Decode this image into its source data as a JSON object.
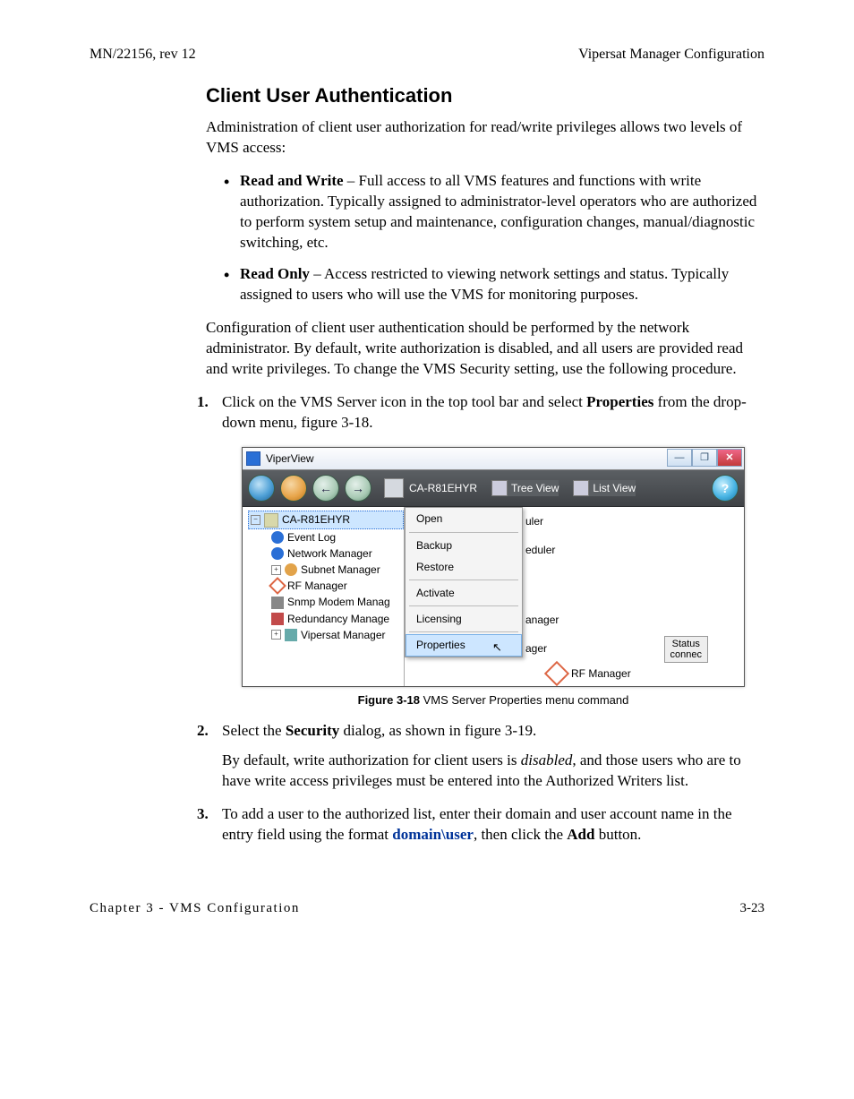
{
  "header": {
    "left": "MN/22156, rev 12",
    "right": "Vipersat Manager Configuration"
  },
  "section_title": "Client User Authentication",
  "intro": "Administration of client user authorization for read/write privileges allows two levels of VMS access:",
  "bullets": [
    {
      "bold": "Read and Write",
      "rest": " – Full access to all VMS features and functions with write authorization. Typically assigned to administrator-level operators who are authorized to perform system setup and maintenance, configuration changes, manual/diagnostic switching, etc."
    },
    {
      "bold": "Read Only",
      "rest": " – Access restricted to viewing network settings and status. Typically assigned to users who will use the VMS for monitoring purposes."
    }
  ],
  "config_para": "Configuration of client user authentication should be performed by the network administrator. By default, write authorization is disabled, and all users are provided read and write privileges. To change the VMS Security setting, use the following procedure.",
  "steps": {
    "one": {
      "num": "1.",
      "pre": "Click on the VMS Server icon in the top tool bar and select ",
      "bold": "Properties",
      "post": " from the drop-down menu, figure 3-18."
    },
    "two": {
      "num": "2.",
      "pre": "Select the ",
      "bold": "Security",
      "post": " dialog, as shown in figure 3-19.",
      "sub_pre": "By default, write authorization for client users is ",
      "sub_ital": "disabled",
      "sub_post": ", and those users who are to have write access privileges must be entered into the Authorized Writers list."
    },
    "three": {
      "num": "3.",
      "pre": "To add a user to the authorized list, enter their domain and user account name in the entry field using the format ",
      "blue": "domain\\user",
      "mid": ", then click the ",
      "bold": "Add",
      "post": " button."
    }
  },
  "figure": {
    "label_bold": "Figure 3-18",
    "label_rest": "   VMS Server Properties menu command"
  },
  "window": {
    "title": "ViperView",
    "server_name": "CA-R81EHYR",
    "tree_view": "Tree View",
    "list_view": "List View",
    "tree": {
      "root": "CA-R81EHYR",
      "items": [
        "Event Log",
        "Network Manager",
        "Subnet Manager",
        "RF Manager",
        "Snmp Modem Manag",
        "Redundancy Manage",
        "Vipersat Manager"
      ]
    },
    "context_menu": [
      "Open",
      "Backup",
      "Restore",
      "Activate",
      "Licensing",
      "Properties"
    ],
    "bg_labels": {
      "a": "uler",
      "b": "eduler",
      "c": "anager",
      "d": "ager"
    },
    "status": {
      "l1": "Status",
      "l2": "connec"
    },
    "rf_label": "RF Manager"
  },
  "footer": {
    "left": "Chapter 3 - VMS Configuration",
    "right": "3-23"
  }
}
